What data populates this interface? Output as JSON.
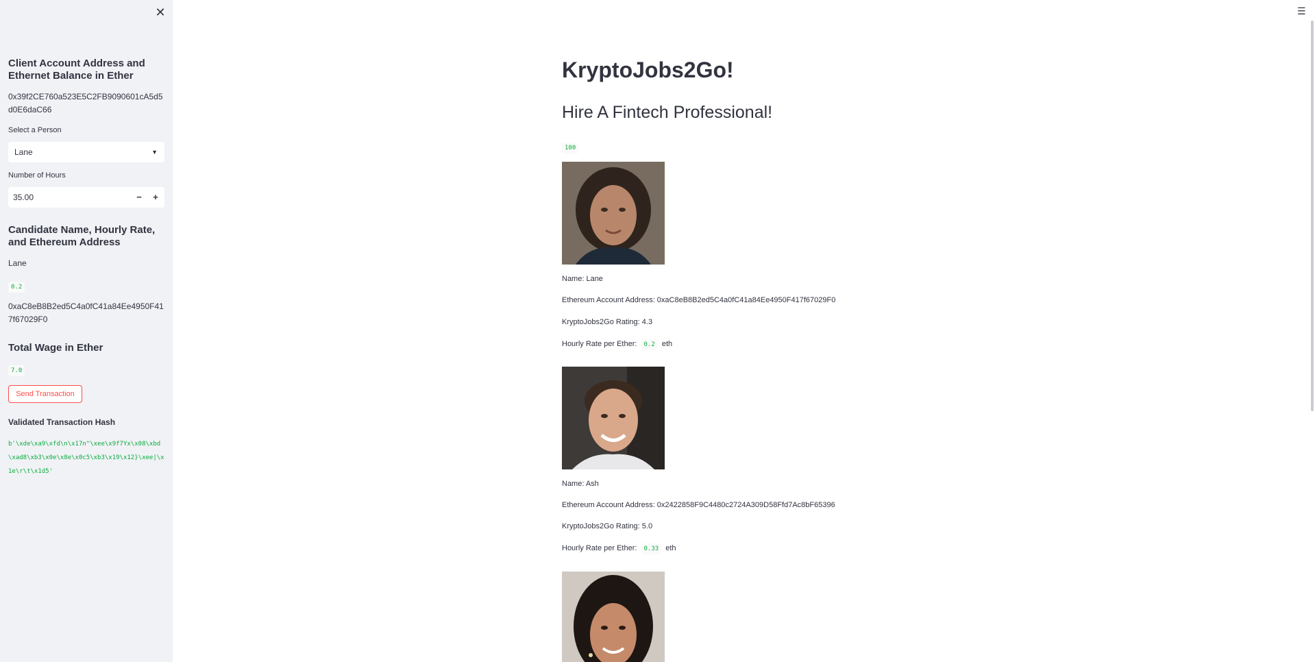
{
  "sidebar": {
    "close_icon": "close-icon",
    "account_heading": "Client Account Address and Ethernet Balance in Ether",
    "account_address": "0x39f2CE760a523E5C2FB9090601cA5d5d0E6daC66",
    "select_label": "Select a Person",
    "selected_person": "Lane",
    "hours_label": "Number of Hours",
    "hours_value": "35.00",
    "minus": "−",
    "plus": "+",
    "candidate_heading": "Candidate Name, Hourly Rate, and Ethereum Address",
    "candidate_name": "Lane",
    "candidate_rate": "0.2",
    "candidate_address": "0xaC8eB8B2ed5C4a0fC41a84Ee4950F417f67029F0",
    "wage_heading": "Total Wage in Ether",
    "wage_value": "7.0",
    "send_button": "Send Transaction",
    "hash_heading": "Validated Transaction Hash",
    "hash_value": "b'\\xde\\xa9\\xfd\\n\\x17n\"\\xee\\x9f7Yx\\x08\\xbd\\xad8\\xb3\\x0e\\x8e\\x0c5\\xb3\\x19\\x12}\\xee|\\x1e\\r\\t\\x1d5'"
  },
  "main": {
    "menu_icon": "hamburger-menu-icon",
    "title": "KryptoJobs2Go!",
    "subtitle": "Hire A Fintech Professional!",
    "count": "100",
    "rate_unit": "eth",
    "candidates": [
      {
        "name": "Name: Lane",
        "address": "Ethereum Account Address: 0xaC8eB8B2ed5C4a0fC41a84Ee4950F417f67029F0",
        "rating": "KryptoJobs2Go Rating: 4.3",
        "rate_label": "Hourly Rate per Ether:",
        "rate": "0.2"
      },
      {
        "name": "Name: Ash",
        "address": "Ethereum Account Address: 0x2422858F9C4480c2724A309D58Ffd7Ac8bF65396",
        "rating": "KryptoJobs2Go Rating: 5.0",
        "rate_label": "Hourly Rate per Ether:",
        "rate": "0.33"
      }
    ]
  }
}
